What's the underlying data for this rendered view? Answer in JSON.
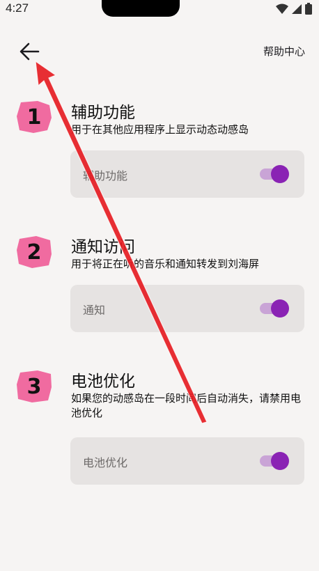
{
  "status_bar": {
    "time": "4:27"
  },
  "header": {
    "help_label": "帮助中心"
  },
  "sections": [
    {
      "number": "1",
      "title": "辅助功能",
      "description": "用于在其他应用程序上显示动态动感岛",
      "toggle_label": "辅助功能",
      "toggle_on": true
    },
    {
      "number": "2",
      "title": "通知访问",
      "description": "用于将正在听的音乐和通知转发到刘海屏",
      "toggle_label": "通知",
      "toggle_on": true
    },
    {
      "number": "3",
      "title": "电池优化",
      "description": "如果您的动感岛在一段时间后自动消失，请禁用电池优化",
      "toggle_label": "电池优化",
      "toggle_on": true
    }
  ],
  "colors": {
    "accent": "#8a23b4",
    "badge": "#f06ba0",
    "annotation_arrow": "#e51c23"
  }
}
